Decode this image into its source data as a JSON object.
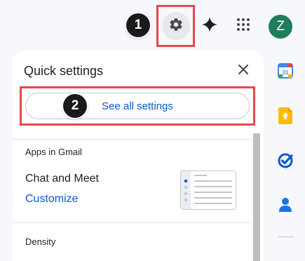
{
  "steps": {
    "one": "1",
    "two": "2"
  },
  "header": {
    "avatar_letter": "Z"
  },
  "quick_settings": {
    "title": "Quick settings",
    "see_all_label": "See all settings",
    "apps_section_label": "Apps in Gmail",
    "chat_meet_label": "Chat and Meet",
    "customize_label": "Customize",
    "density_label": "Density"
  },
  "sidebar": {
    "calendar_day": "31"
  },
  "colors": {
    "highlight": "#e5484d",
    "link": "#0b57d0",
    "avatar": "#1e7d5a",
    "step_badge": "#1a1a1a"
  }
}
